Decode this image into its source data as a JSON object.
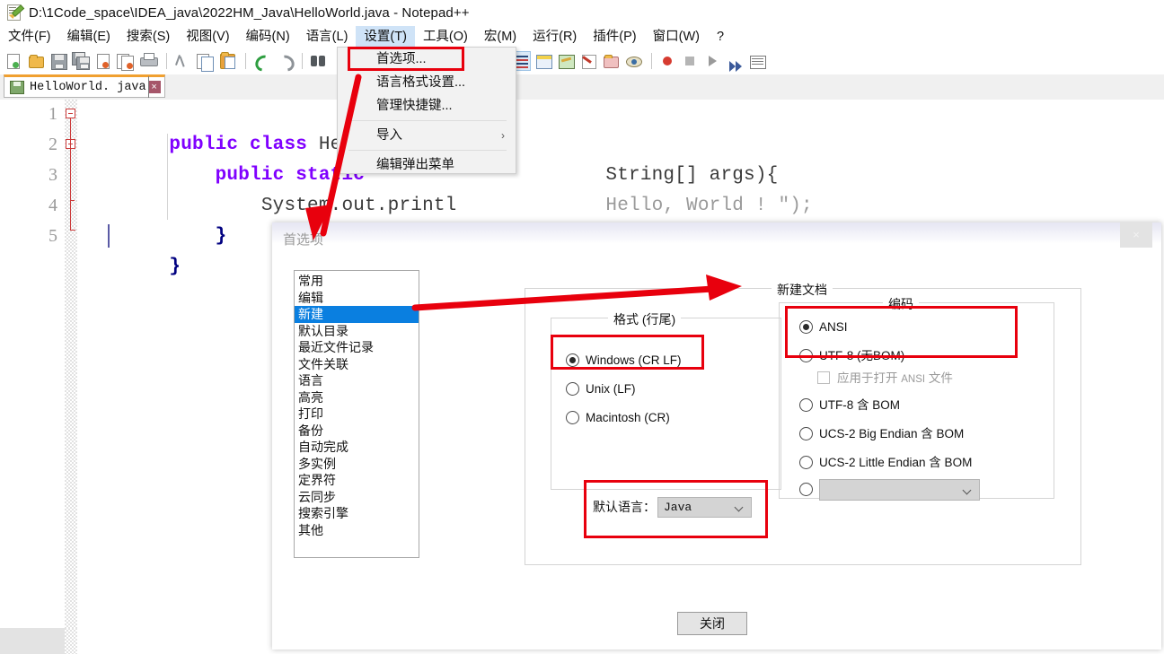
{
  "window": {
    "title": "D:\\1Code_space\\IDEA_java\\2022HM_Java\\HelloWorld.java - Notepad++",
    "app_icon": "notepad-plus-plus-icon"
  },
  "menubar": {
    "items": [
      {
        "label": "文件(F)",
        "active": false
      },
      {
        "label": "编辑(E)",
        "active": false
      },
      {
        "label": "搜索(S)",
        "active": false
      },
      {
        "label": "视图(V)",
        "active": false
      },
      {
        "label": "编码(N)",
        "active": false
      },
      {
        "label": "语言(L)",
        "active": false
      },
      {
        "label": "设置(T)",
        "active": true
      },
      {
        "label": "工具(O)",
        "active": false
      },
      {
        "label": "宏(M)",
        "active": false
      },
      {
        "label": "运行(R)",
        "active": false
      },
      {
        "label": "插件(P)",
        "active": false
      },
      {
        "label": "窗口(W)",
        "active": false
      },
      {
        "label": "?",
        "active": false
      }
    ]
  },
  "toolbar": {
    "icons": [
      "new-file-icon",
      "open-folder-icon",
      "save-icon",
      "save-all-icon",
      "close-file-icon",
      "close-all-icon",
      "print-icon",
      "cut-icon",
      "copy-icon",
      "paste-icon",
      "undo-icon",
      "redo-icon",
      "find-icon",
      "word-wrap-icon",
      "all-chars-icon",
      "indent-guide-icon",
      "zoom-icon",
      "sync-scroll-icon",
      "doc-map-icon",
      "function-list-icon",
      "folder-as-workspace-icon",
      "monitoring-icon",
      "record-macro-icon",
      "stop-macro-icon",
      "play-macro-icon",
      "run-macro-multiple-icon",
      "run-icon"
    ]
  },
  "tabbar": {
    "tabs": [
      {
        "label": "HelloWorld. java",
        "icon": "saved-disk-icon",
        "close": "×",
        "active": true
      }
    ]
  },
  "editor": {
    "line_numbers": [
      "1",
      "2",
      "3",
      "4",
      "5"
    ],
    "lines": [
      {
        "tokens": [
          {
            "t": "public class ",
            "c": "kw"
          },
          {
            "t": "Hell",
            "c": "plain"
          }
        ]
      },
      {
        "tokens": [
          {
            "t": "    public static",
            "c": "kw"
          }
        ]
      },
      {
        "tokens": [
          {
            "t": "        System.out.printl",
            "c": "plain"
          }
        ]
      },
      {
        "tokens": [
          {
            "t": "    }",
            "c": "brace"
          }
        ]
      },
      {
        "tokens": [
          {
            "t": "}",
            "c": "brace"
          }
        ]
      }
    ],
    "line2_tail": "String[] args){",
    "line3_tail": "Hello, World ! \");"
  },
  "settings_menu": {
    "items": [
      {
        "label": "首选项...",
        "submenu": false,
        "highlighted": true
      },
      {
        "label": "语言格式设置...",
        "submenu": false
      },
      {
        "label": "管理快捷键...",
        "submenu": false
      },
      {
        "label": "导入",
        "submenu": true,
        "chevron": "›"
      },
      {
        "label": "编辑弹出菜单",
        "submenu": false
      }
    ]
  },
  "dialog": {
    "title": "首选项",
    "close_glyph": "×",
    "categories": [
      {
        "label": "常用",
        "selected": false
      },
      {
        "label": "编辑",
        "selected": false
      },
      {
        "label": "新建",
        "selected": true
      },
      {
        "label": "默认目录",
        "selected": false
      },
      {
        "label": "最近文件记录",
        "selected": false
      },
      {
        "label": "文件关联",
        "selected": false
      },
      {
        "label": "语言",
        "selected": false
      },
      {
        "label": "高亮",
        "selected": false
      },
      {
        "label": "打印",
        "selected": false
      },
      {
        "label": "备份",
        "selected": false
      },
      {
        "label": "自动完成",
        "selected": false
      },
      {
        "label": "多实例",
        "selected": false
      },
      {
        "label": "定界符",
        "selected": false
      },
      {
        "label": "云同步",
        "selected": false
      },
      {
        "label": "搜索引擎",
        "selected": false
      },
      {
        "label": "其他",
        "selected": false
      }
    ],
    "new_document_group": {
      "legend": "新建文档"
    },
    "format_group": {
      "legend": "格式 (行尾)",
      "options": [
        {
          "label": "Windows (CR LF)",
          "checked": true
        },
        {
          "label": "Unix (LF)",
          "checked": false
        },
        {
          "label": "Macintosh (CR)",
          "checked": false
        }
      ]
    },
    "encoding_group": {
      "legend": "编码",
      "options": [
        {
          "label": "ANSI",
          "checked": true
        },
        {
          "label": "UTF-8 (无BOM)",
          "checked": false
        },
        {
          "label": "UTF-8 含 BOM",
          "checked": false
        },
        {
          "label": "UCS-2 Big Endian 含 BOM",
          "checked": false
        },
        {
          "label": "UCS-2 Little Endian 含 BOM",
          "checked": false
        },
        {
          "label": "",
          "checked": false
        }
      ],
      "sub_checkbox": {
        "label_a": "应用于打开 ",
        "label_b": "ANSI",
        "label_c": " 文件",
        "checked": false
      },
      "combo_value": ""
    },
    "default_language": {
      "label": "默认语言：",
      "value": "Java"
    },
    "close_button": {
      "label": "关闭"
    }
  },
  "annotations": {
    "accent_color": "#e8000d",
    "boxes": [
      {
        "name": "preferences-menu-item-highlight"
      },
      {
        "name": "windows-crlf-highlight"
      },
      {
        "name": "ansi-encoding-highlight"
      },
      {
        "name": "default-language-highlight"
      }
    ],
    "arrows": [
      {
        "name": "arrow-menu-to-dialog"
      },
      {
        "name": "arrow-new-category-to-new-document"
      }
    ]
  }
}
